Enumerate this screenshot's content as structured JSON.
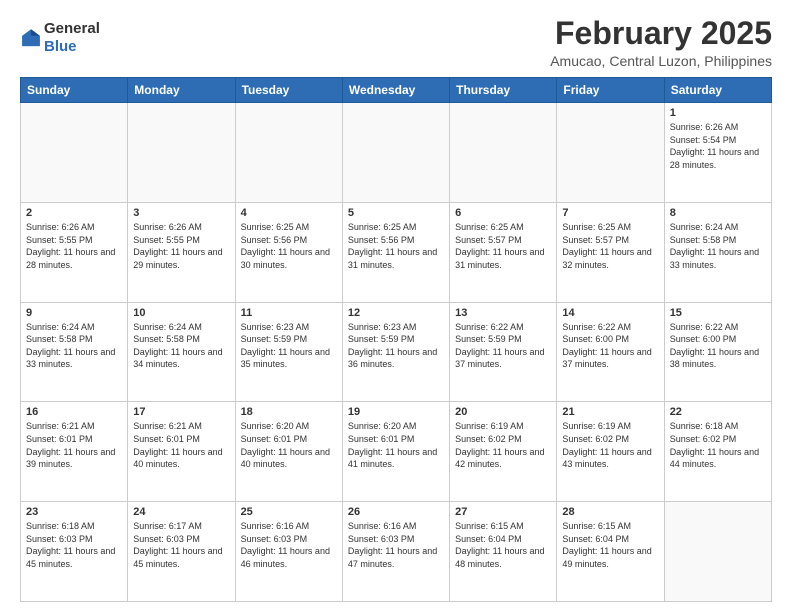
{
  "header": {
    "logo_line1": "General",
    "logo_line2": "Blue",
    "month_year": "February 2025",
    "location": "Amucao, Central Luzon, Philippines"
  },
  "weekdays": [
    "Sunday",
    "Monday",
    "Tuesday",
    "Wednesday",
    "Thursday",
    "Friday",
    "Saturday"
  ],
  "weeks": [
    [
      {
        "day": "",
        "info": ""
      },
      {
        "day": "",
        "info": ""
      },
      {
        "day": "",
        "info": ""
      },
      {
        "day": "",
        "info": ""
      },
      {
        "day": "",
        "info": ""
      },
      {
        "day": "",
        "info": ""
      },
      {
        "day": "1",
        "info": "Sunrise: 6:26 AM\nSunset: 5:54 PM\nDaylight: 11 hours and 28 minutes."
      }
    ],
    [
      {
        "day": "2",
        "info": "Sunrise: 6:26 AM\nSunset: 5:55 PM\nDaylight: 11 hours and 28 minutes."
      },
      {
        "day": "3",
        "info": "Sunrise: 6:26 AM\nSunset: 5:55 PM\nDaylight: 11 hours and 29 minutes."
      },
      {
        "day": "4",
        "info": "Sunrise: 6:25 AM\nSunset: 5:56 PM\nDaylight: 11 hours and 30 minutes."
      },
      {
        "day": "5",
        "info": "Sunrise: 6:25 AM\nSunset: 5:56 PM\nDaylight: 11 hours and 31 minutes."
      },
      {
        "day": "6",
        "info": "Sunrise: 6:25 AM\nSunset: 5:57 PM\nDaylight: 11 hours and 31 minutes."
      },
      {
        "day": "7",
        "info": "Sunrise: 6:25 AM\nSunset: 5:57 PM\nDaylight: 11 hours and 32 minutes."
      },
      {
        "day": "8",
        "info": "Sunrise: 6:24 AM\nSunset: 5:58 PM\nDaylight: 11 hours and 33 minutes."
      }
    ],
    [
      {
        "day": "9",
        "info": "Sunrise: 6:24 AM\nSunset: 5:58 PM\nDaylight: 11 hours and 33 minutes."
      },
      {
        "day": "10",
        "info": "Sunrise: 6:24 AM\nSunset: 5:58 PM\nDaylight: 11 hours and 34 minutes."
      },
      {
        "day": "11",
        "info": "Sunrise: 6:23 AM\nSunset: 5:59 PM\nDaylight: 11 hours and 35 minutes."
      },
      {
        "day": "12",
        "info": "Sunrise: 6:23 AM\nSunset: 5:59 PM\nDaylight: 11 hours and 36 minutes."
      },
      {
        "day": "13",
        "info": "Sunrise: 6:22 AM\nSunset: 5:59 PM\nDaylight: 11 hours and 37 minutes."
      },
      {
        "day": "14",
        "info": "Sunrise: 6:22 AM\nSunset: 6:00 PM\nDaylight: 11 hours and 37 minutes."
      },
      {
        "day": "15",
        "info": "Sunrise: 6:22 AM\nSunset: 6:00 PM\nDaylight: 11 hours and 38 minutes."
      }
    ],
    [
      {
        "day": "16",
        "info": "Sunrise: 6:21 AM\nSunset: 6:01 PM\nDaylight: 11 hours and 39 minutes."
      },
      {
        "day": "17",
        "info": "Sunrise: 6:21 AM\nSunset: 6:01 PM\nDaylight: 11 hours and 40 minutes."
      },
      {
        "day": "18",
        "info": "Sunrise: 6:20 AM\nSunset: 6:01 PM\nDaylight: 11 hours and 40 minutes."
      },
      {
        "day": "19",
        "info": "Sunrise: 6:20 AM\nSunset: 6:01 PM\nDaylight: 11 hours and 41 minutes."
      },
      {
        "day": "20",
        "info": "Sunrise: 6:19 AM\nSunset: 6:02 PM\nDaylight: 11 hours and 42 minutes."
      },
      {
        "day": "21",
        "info": "Sunrise: 6:19 AM\nSunset: 6:02 PM\nDaylight: 11 hours and 43 minutes."
      },
      {
        "day": "22",
        "info": "Sunrise: 6:18 AM\nSunset: 6:02 PM\nDaylight: 11 hours and 44 minutes."
      }
    ],
    [
      {
        "day": "23",
        "info": "Sunrise: 6:18 AM\nSunset: 6:03 PM\nDaylight: 11 hours and 45 minutes."
      },
      {
        "day": "24",
        "info": "Sunrise: 6:17 AM\nSunset: 6:03 PM\nDaylight: 11 hours and 45 minutes."
      },
      {
        "day": "25",
        "info": "Sunrise: 6:16 AM\nSunset: 6:03 PM\nDaylight: 11 hours and 46 minutes."
      },
      {
        "day": "26",
        "info": "Sunrise: 6:16 AM\nSunset: 6:03 PM\nDaylight: 11 hours and 47 minutes."
      },
      {
        "day": "27",
        "info": "Sunrise: 6:15 AM\nSunset: 6:04 PM\nDaylight: 11 hours and 48 minutes."
      },
      {
        "day": "28",
        "info": "Sunrise: 6:15 AM\nSunset: 6:04 PM\nDaylight: 11 hours and 49 minutes."
      },
      {
        "day": "",
        "info": ""
      }
    ]
  ]
}
